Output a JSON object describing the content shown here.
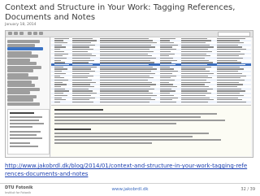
{
  "slide": {
    "title": "Context and Structure in Your Work: Tagging References, Documents and Notes",
    "date": "January 18, 2014",
    "url": "http://www.jakobrdl.dk/blog/2014/01/context-and-structure-in-your-work-tagging-references-documents-and-notes",
    "footer_logo_main": "DTU Fotonik",
    "footer_logo_sub": "Institut for Fotonik",
    "footer_site": "www.jakobrdl.dk",
    "page_number": "32 / 39"
  },
  "screenshot": {
    "selected_row_index": 12,
    "row_count": 30,
    "sidebar_selected_index": 2
  },
  "colors": {
    "link": "#1b3fb0",
    "selection": "#3d6fbe",
    "site": "#3b6abf"
  }
}
